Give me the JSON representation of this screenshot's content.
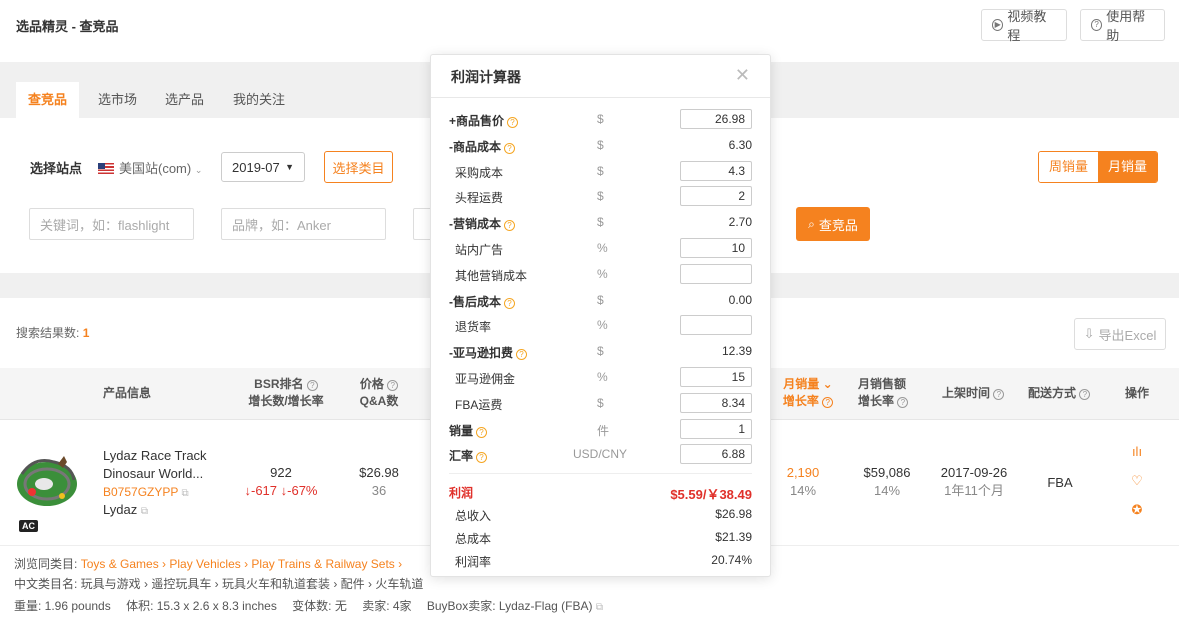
{
  "header": {
    "breadcrumb": "选品精灵 - 查竞品",
    "video_btn": "视频教程",
    "help_btn": "使用帮助"
  },
  "tabs": [
    "查竞品",
    "选市场",
    "选产品",
    "我的关注"
  ],
  "filters": {
    "site_label": "选择站点",
    "site_value": "美国站(com)",
    "month": "2019-07",
    "category_btn": "选择类目",
    "keyword_placeholder": "关键词，如：flashlight",
    "brand_placeholder": "品牌，如：Anker",
    "search_btn": "查竞品",
    "weekly": "周销量",
    "monthly": "月销量"
  },
  "results": {
    "count_label": "搜索结果数:",
    "count": "1",
    "export": "导出Excel"
  },
  "table": {
    "headers": {
      "product": "产品信息",
      "bsr_1": "BSR排名",
      "bsr_2": "增长数/增长率",
      "price_1": "价格",
      "price_2": "Q&A数",
      "month_sales_1": "月销量",
      "month_sales_2": "增长率",
      "month_rev_1": "月销售额",
      "month_rev_2": "增长率",
      "listed": "上架时间",
      "delivery": "配送方式",
      "ops": "操作"
    },
    "row": {
      "title_1": "Lydaz Race Track",
      "title_2": "Dinosaur World...",
      "asin": "B0757GZYPP",
      "brand": "Lydaz",
      "badge": "AC",
      "bsr": "922",
      "bsr_change": "↓-617 ↓-67%",
      "price": "$26.98",
      "qa": "36",
      "month_sales": "2,190",
      "month_sales_rate": "14%",
      "month_rev": "$59,086",
      "month_rev_rate": "14%",
      "listed_date": "2017-09-26",
      "listed_age": "1年11个月",
      "delivery": "FBA"
    }
  },
  "details": {
    "browse_label": "浏览同类目:",
    "browse_path": "Toys & Games › Play Vehicles › Play Trains & Railway Sets ›",
    "cn_category": "中文类目名: 玩具与游戏 › 遥控玩具车 › 玩具火车和轨道套装 › 配件 › 火车轨道",
    "weight": "重量: 1.96 pounds",
    "volume": "体积: 15.3 x 2.6 x 8.3 inches",
    "variants": "变体数: 无",
    "sellers": "卖家: 4家",
    "buybox": "BuyBox卖家: Lydaz-Flag (FBA)"
  },
  "calculator": {
    "title": "利润计算器",
    "rows": [
      {
        "name": "+商品售价",
        "unit": "$",
        "value": "26.98",
        "input": true,
        "bold": true,
        "help": true
      },
      {
        "name": "-商品成本",
        "unit": "$",
        "value": "6.30",
        "input": false,
        "bold": true,
        "help": true
      },
      {
        "name": "采购成本",
        "unit": "$",
        "value": "4.3",
        "input": true,
        "bold": false,
        "help": false
      },
      {
        "name": "头程运费",
        "unit": "$",
        "value": "2",
        "input": true,
        "bold": false,
        "help": false
      },
      {
        "name": "-营销成本",
        "unit": "$",
        "value": "2.70",
        "input": false,
        "bold": true,
        "help": true
      },
      {
        "name": "站内广告",
        "unit": "%",
        "value": "10",
        "input": true,
        "bold": false,
        "help": false
      },
      {
        "name": "其他营销成本",
        "unit": "%",
        "value": "",
        "input": true,
        "bold": false,
        "help": false
      },
      {
        "name": "-售后成本",
        "unit": "$",
        "value": "0.00",
        "input": false,
        "bold": true,
        "help": true
      },
      {
        "name": "退货率",
        "unit": "%",
        "value": "",
        "input": true,
        "bold": false,
        "help": false
      },
      {
        "name": "-亚马逊扣费",
        "unit": "$",
        "value": "12.39",
        "input": false,
        "bold": true,
        "help": true
      },
      {
        "name": "亚马逊佣金",
        "unit": "%",
        "value": "15",
        "input": true,
        "bold": false,
        "help": false
      },
      {
        "name": "FBA运费",
        "unit": "$",
        "value": "8.34",
        "input": true,
        "bold": false,
        "help": false
      },
      {
        "name": "销量",
        "unit": "件",
        "value": "1",
        "input": true,
        "bold": true,
        "help": true
      },
      {
        "name": "汇率",
        "unit": "USD/CNY",
        "value": "6.88",
        "input": true,
        "bold": true,
        "help": true
      }
    ],
    "profit_label": "利润",
    "profit_value": "$5.59/￥38.49",
    "total_income_label": "总收入",
    "total_income": "$26.98",
    "total_cost_label": "总成本",
    "total_cost": "$21.39",
    "margin_label": "利润率",
    "margin": "20.74%"
  }
}
